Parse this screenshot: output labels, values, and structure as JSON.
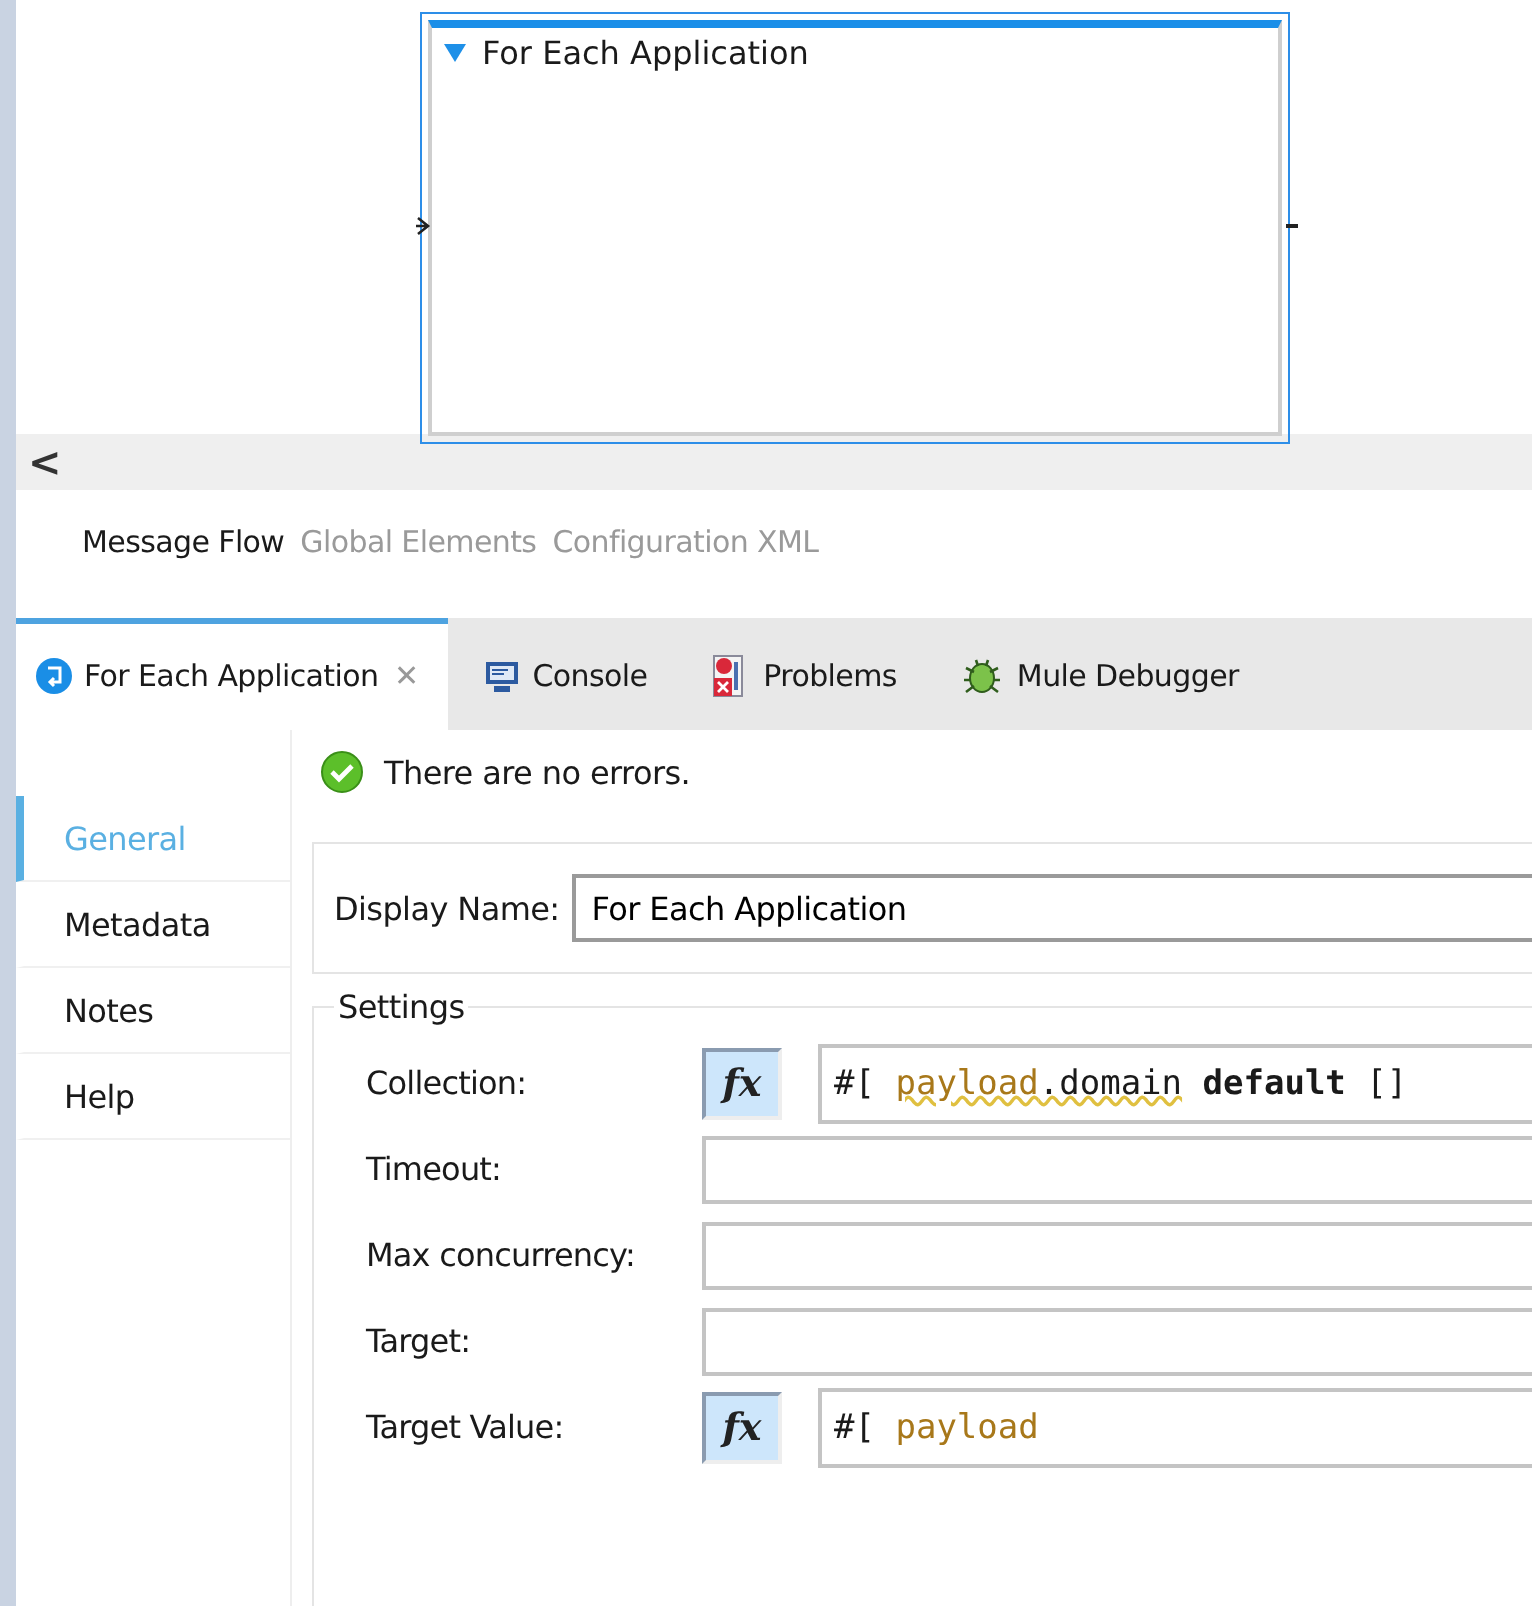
{
  "canvas": {
    "scope": {
      "title": "For Each Application",
      "expanded": true
    }
  },
  "scroll": {
    "arrow": "<"
  },
  "editor_tabs": [
    {
      "label": "Message Flow",
      "selected": true
    },
    {
      "label": "Global Elements",
      "selected": false
    },
    {
      "label": "Configuration XML",
      "selected": false
    }
  ],
  "panel_tabs": [
    {
      "label": "For Each Application",
      "selected": true,
      "kind": "scope",
      "closable": true,
      "close": "✕"
    },
    {
      "label": "Console",
      "selected": false,
      "kind": "console",
      "closable": false
    },
    {
      "label": "Problems",
      "selected": false,
      "kind": "problems",
      "closable": false
    },
    {
      "label": "Mule Debugger",
      "selected": false,
      "kind": "debugger",
      "closable": false
    }
  ],
  "status": {
    "message": "There are no errors."
  },
  "nav": [
    {
      "label": "General",
      "selected": true
    },
    {
      "label": "Metadata",
      "selected": false
    },
    {
      "label": "Notes",
      "selected": false
    },
    {
      "label": "Help",
      "selected": false
    }
  ],
  "display_name": {
    "label": "Display Name:",
    "value": "For Each Application"
  },
  "settings": {
    "title": "Settings",
    "fields": [
      {
        "label": "Collection:",
        "kind": "expression",
        "fx": "fx",
        "tokens": [
          {
            "text": "#[ ",
            "kind": "punct"
          },
          {
            "text": "payload",
            "kind": "ident",
            "squiggle": true
          },
          {
            "text": ".domain",
            "kind": "plain",
            "squiggle": true
          },
          {
            "text": " default",
            "kind": "keyword"
          },
          {
            "text": " []",
            "kind": "plain"
          }
        ]
      },
      {
        "label": "Timeout:",
        "kind": "text"
      },
      {
        "label": "Max concurrency:",
        "kind": "text"
      },
      {
        "label": "Target:",
        "kind": "text"
      },
      {
        "label": "Target Value:",
        "kind": "expression",
        "fx": "fx",
        "tokens": [
          {
            "text": "#[ ",
            "kind": "punct"
          },
          {
            "text": "payload",
            "kind": "ident",
            "squiggle": false
          }
        ]
      }
    ]
  }
}
